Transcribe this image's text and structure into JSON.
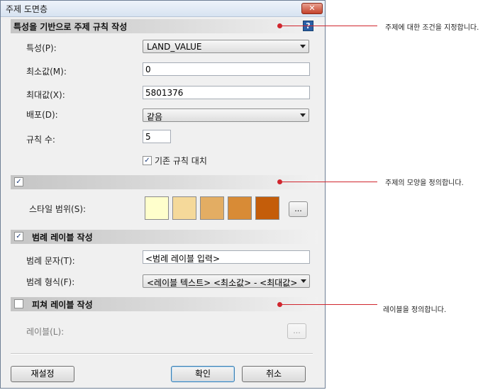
{
  "window": {
    "title": "주제 도면층"
  },
  "sections": {
    "rules": {
      "title": "특성을 기반으로 주제 규칙 작성",
      "help_icon": "?"
    },
    "style": {
      "title": ""
    },
    "legend": {
      "title": "범례 레이블 작성"
    },
    "feature": {
      "title": "피쳐 레이블 작성"
    }
  },
  "fields": {
    "property_label": "특성(P):",
    "property_value": "LAND_VALUE",
    "min_label": "최소값(M):",
    "min_value": "0",
    "max_label": "최대값(X):",
    "max_value": "5801376",
    "distribution_label": "배포(D):",
    "distribution_value": "같음",
    "rule_count_label": "규칙 수:",
    "rule_count_value": "5",
    "replace_rules_label": "기존 규칙 대치",
    "style_range_label": "스타일 범위(S):",
    "style_range_button": "...",
    "swatches": [
      "#ffffcc",
      "#f5d99a",
      "#e3ad63",
      "#d88b36",
      "#c45d0a"
    ],
    "legend_text_label": "범례 문자(T):",
    "legend_text_value": "<범례 레이블 입력>",
    "legend_format_label": "범례 형식(F):",
    "legend_format_value": "<레이블 텍스트> <최소값> - <최대값>",
    "feature_label_label": "레이블(L):",
    "feature_label_button": "..."
  },
  "checkboxes": {
    "replace_rules": true,
    "style_section": true,
    "legend_section": true,
    "feature_section": false
  },
  "buttons": {
    "reset": "재설정",
    "ok": "확인",
    "cancel": "취소"
  },
  "callouts": {
    "rules": "주제에 대한 조건을 지정합니다.",
    "style": "주제의 모양을 정의합니다.",
    "labels": "레이블을 정의합니다."
  },
  "colors": {
    "callout": "#d0262e",
    "accent": "#2a5fa7"
  }
}
